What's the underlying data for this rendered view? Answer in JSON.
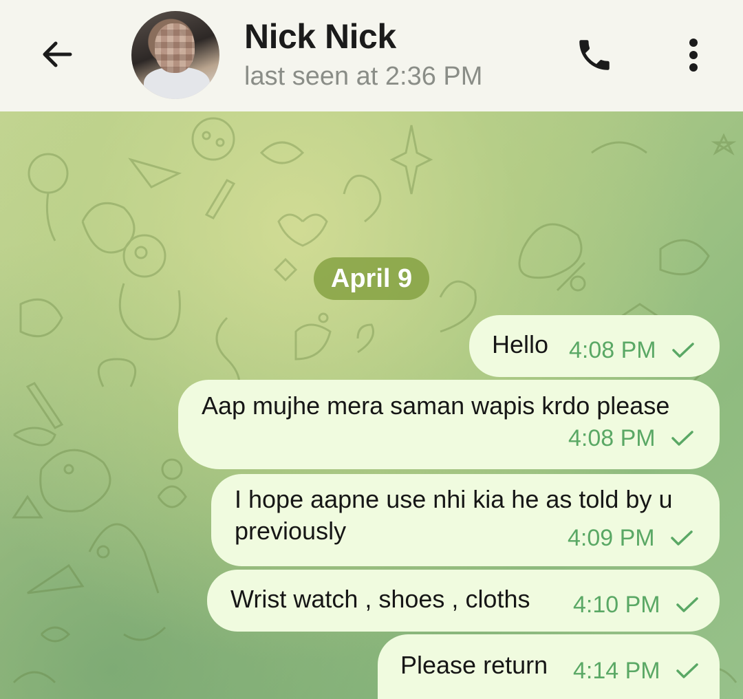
{
  "header": {
    "back_icon": "arrow-left-icon",
    "contact_name": "Nick Nick",
    "status": "last seen at 2:36 PM",
    "call_icon": "phone-icon",
    "menu_icon": "more-vertical-icon"
  },
  "chat": {
    "date_separator": "April 9",
    "messages": [
      {
        "text": "Hello",
        "time": "4:08 PM",
        "status": "sent",
        "status_icon": "check-icon"
      },
      {
        "text": "Aap mujhe mera saman wapis krdo please",
        "time": "4:08 PM",
        "status": "sent",
        "status_icon": "check-icon"
      },
      {
        "text": "I hope aapne use nhi kia he as told by u previously",
        "time": "4:09 PM",
        "status": "sent",
        "status_icon": "check-icon"
      },
      {
        "text": "Wrist watch , shoes , cloths",
        "time": "4:10 PM",
        "status": "sent",
        "status_icon": "check-icon"
      },
      {
        "text": "Please return",
        "time": "4:14 PM",
        "status": "sent",
        "status_icon": "check-icon"
      }
    ]
  },
  "colors": {
    "header_bg": "#f5f5ee",
    "bubble_bg": "#f0fbdf",
    "time_accent": "#5aa865",
    "date_pill_bg": "#809e3c"
  }
}
